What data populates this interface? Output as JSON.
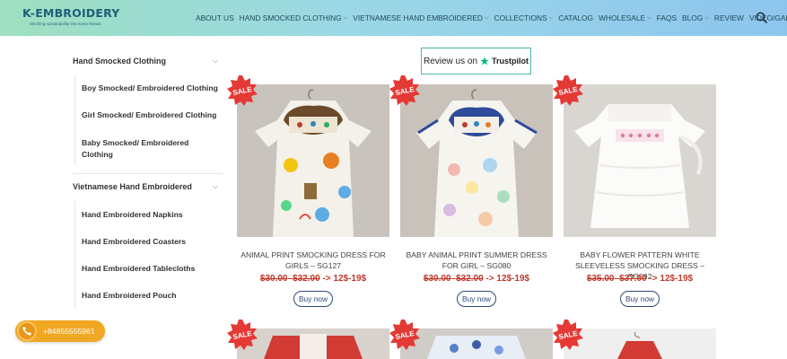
{
  "header": {
    "logo_title": "K-EMBROIDERY",
    "logo_tagline": "Stitching sustainability into every thread",
    "nav": [
      {
        "label": "ABOUT US",
        "has_dropdown": false
      },
      {
        "label": "HAND SMOCKED CLOTHING",
        "has_dropdown": true
      },
      {
        "label": "VIETNAMESE HAND EMBROIDERED",
        "has_dropdown": true
      },
      {
        "label": "COLLECTIONS",
        "has_dropdown": true
      },
      {
        "label": "CATALOG",
        "has_dropdown": false
      },
      {
        "label": "WHOLESALE",
        "has_dropdown": true
      },
      {
        "label": "FAQS",
        "has_dropdown": false
      },
      {
        "label": "BLOG",
        "has_dropdown": true
      },
      {
        "label": "REVIEW",
        "has_dropdown": false
      },
      {
        "label": "VIDEO/GALLERY",
        "has_dropdown": false
      }
    ],
    "search_icon": "search-icon"
  },
  "sidebar": {
    "categories": [
      {
        "title": "Hand Smocked Clothing",
        "items": [
          "Boy Smocked/ Embroidered Clothing",
          "Girl Smocked/ Embroidered Clothing",
          "Baby Smocked/ Embroidered Clothing"
        ]
      },
      {
        "title": "Vietnamese Hand Embroidered",
        "items": [
          "Hand Embroidered Napkins",
          "Hand Embroidered Coasters",
          "Hand Embroidered Tablecloths",
          "Hand Embroidered Pouch"
        ]
      }
    ]
  },
  "trustpilot": {
    "text": "Review us on",
    "brand": "Trustpilot"
  },
  "sale_badge": "SALE",
  "products": [
    {
      "name": "ANIMAL PRINT SMOCKING DRESS FOR GIRLS – SG127",
      "old_price": "$30.00",
      "old_price2": "$32.00",
      "new_price": "-> 12$-19$",
      "button": "Buy now"
    },
    {
      "name": "BABY ANIMAL PRINT SUMMER DRESS FOR GIRL – SG080",
      "old_price": "$30.00",
      "old_price2": "$32.00",
      "new_price": "-> 12$-19$",
      "button": "Buy now"
    },
    {
      "name": "BABY FLOWER PATTERN WHITE SLEEVELESS SMOCKING DRESS – SG092",
      "old_price": "$35.00",
      "old_price2": "$37.00",
      "new_price": "-> 12$-19$",
      "button": "Buy now"
    }
  ],
  "phone": {
    "number": "+84855555961"
  },
  "colors": {
    "accent": "#c0392b",
    "header_start": "#9ee0c0",
    "header_end": "#8ec5ee",
    "button_border": "#2f4a7a",
    "phone_bg": "#f0a722"
  }
}
